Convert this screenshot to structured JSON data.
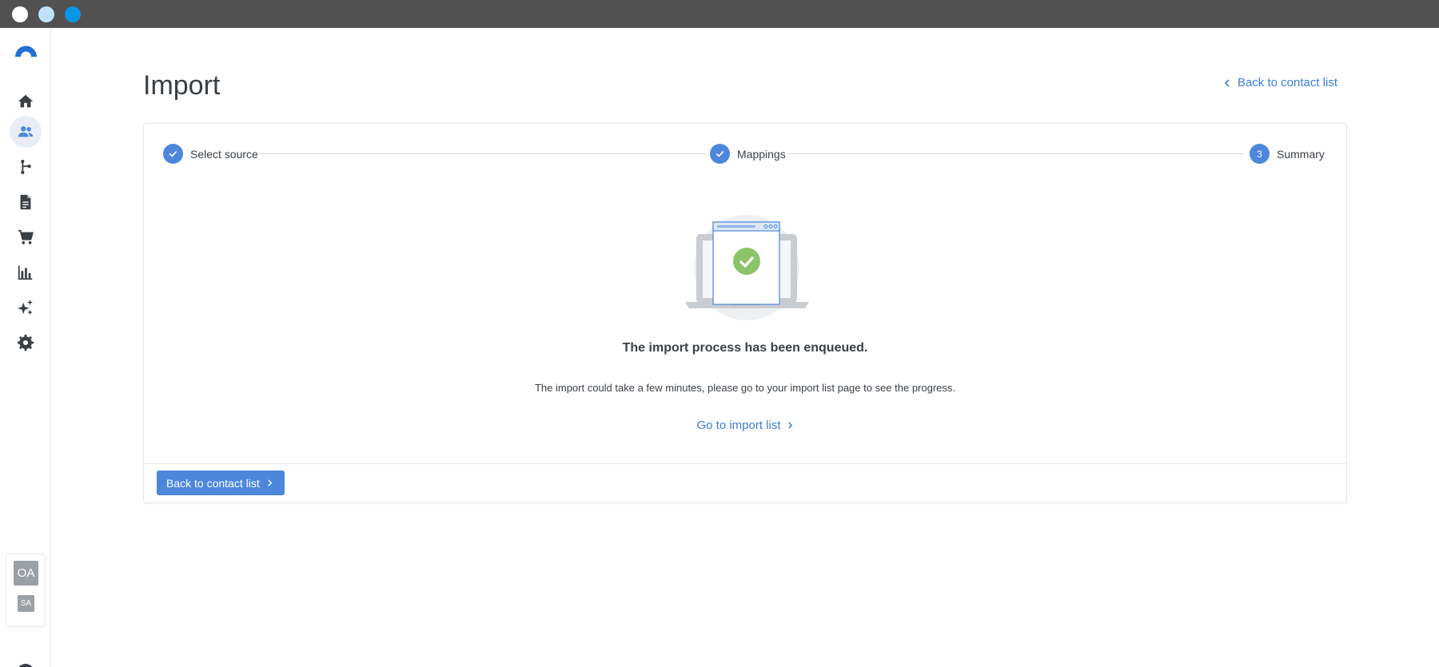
{
  "window": {
    "controls": [
      "close",
      "minimize",
      "maximize"
    ]
  },
  "sidebar": {
    "items": [
      {
        "icon": "home-icon",
        "active": false
      },
      {
        "icon": "contacts-icon",
        "active": true
      },
      {
        "icon": "workflow-icon",
        "active": false
      },
      {
        "icon": "document-icon",
        "active": false
      },
      {
        "icon": "cart-icon",
        "active": false
      },
      {
        "icon": "chart-icon",
        "active": false
      },
      {
        "icon": "sparkles-icon",
        "active": false
      },
      {
        "icon": "gear-icon",
        "active": false
      }
    ],
    "accounts": {
      "primary": "OA",
      "secondary": "SA"
    },
    "user_icon": "user-circle-icon"
  },
  "page": {
    "title": "Import",
    "back_link": "Back to contact list"
  },
  "stepper": {
    "steps": [
      {
        "label": "Select source",
        "status": "done",
        "marker": ""
      },
      {
        "label": "Mappings",
        "status": "done",
        "marker": ""
      },
      {
        "label": "Summary",
        "status": "current",
        "marker": "3"
      }
    ]
  },
  "result": {
    "title": "The import process has been enqueued.",
    "description": "The import could take a few minutes, please go to your import list page to see the progress.",
    "link": "Go to import list"
  },
  "footer": {
    "button": "Back to contact list"
  },
  "colors": {
    "accent": "#4c87dc",
    "link": "#3c7fd6",
    "success": "#8dc46a",
    "titlebar": "#515151"
  }
}
